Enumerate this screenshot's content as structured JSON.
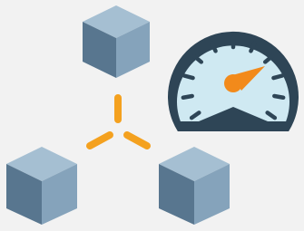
{
  "colors": {
    "background": "#f2f2f2",
    "cube_top": "#a5bfd2",
    "cube_left": "#58768f",
    "cube_right": "#85a3bb",
    "connector": "#f4a11f",
    "gauge_outer": "#2e4556",
    "gauge_face": "#cfe9f2",
    "gauge_ticks": "#2e4556",
    "needle": "#f28a1b"
  },
  "icons": [
    "cube-icon",
    "cube-icon",
    "cube-icon",
    "network-connector-icon",
    "speedometer-gauge-icon"
  ],
  "gauge": {
    "tick_count": 11
  }
}
